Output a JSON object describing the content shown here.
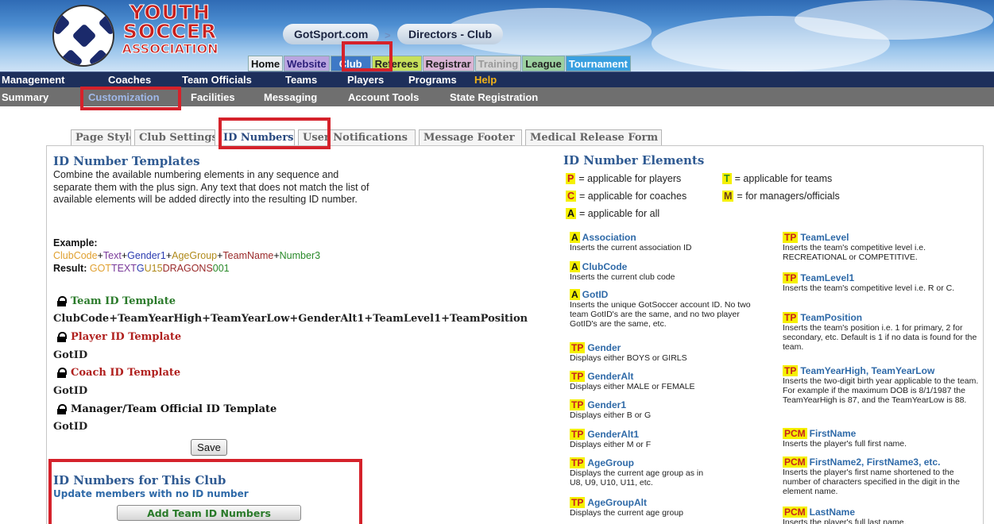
{
  "header": {
    "logo": {
      "line1": "YOUTH",
      "line2": "SOCCER",
      "line3": "ASSOCIATION"
    },
    "breadcrumb": {
      "site": "GotSport.com",
      "separator": ">",
      "section": "Directors - Club"
    },
    "top_nav": [
      "Home",
      "Website",
      "Club",
      "Referees",
      "Registrar",
      "Training",
      "League",
      "Tournament"
    ]
  },
  "menu1": [
    "Management",
    "Coaches",
    "Team Officials",
    "Teams",
    "Players",
    "Programs",
    "Help"
  ],
  "menu2": [
    "Summary",
    "Customization",
    "Facilities",
    "Messaging",
    "Account Tools",
    "State Registration"
  ],
  "tabs": [
    "Page Style",
    "Club Settings",
    "ID Numbers",
    "User Notifications",
    "Message Footer",
    "Medical Release Form"
  ],
  "templates": {
    "title": "ID Number Templates",
    "description": "Combine the available numbering elements in any sequence and separate them with the plus sign. Any text that does not match the list of available elements will be added directly into the resulting ID number.",
    "example_label": "Example:",
    "example_parts": [
      "ClubCode",
      "+",
      "Text",
      "+",
      "Gender1",
      "+",
      "AgeGroup",
      "+",
      "TeamName",
      "+",
      "Number3"
    ],
    "result_label": "Result:",
    "result_parts": [
      "GOT",
      "TEXT",
      "G",
      "U15",
      "DRAGONS",
      "001"
    ],
    "team": {
      "label": "Team ID Template",
      "value": "ClubCode+TeamYearHigh+TeamYearLow+GenderAlt1+TeamLevel1+TeamPosition",
      "color": "#2a7a2a"
    },
    "player": {
      "label": "Player ID Template",
      "value": "GotID",
      "color": "#b0201e"
    },
    "coach": {
      "label": "Coach ID Template",
      "value": "GotID",
      "color": "#b0201e"
    },
    "manager": {
      "label": "Manager/Team Official ID Template",
      "value": "GotID",
      "color": "#111111"
    },
    "save_label": "Save"
  },
  "club_ids": {
    "title": "ID Numbers for This Club",
    "subtitle": "Update members with no ID number",
    "button": "Add Team ID Numbers"
  },
  "elements": {
    "title": "ID Number Elements",
    "legend": [
      {
        "code": "P",
        "text": "= applicable for players"
      },
      {
        "code": "T",
        "text": "= applicable for teams"
      },
      {
        "code": "C",
        "text": "= applicable for coaches"
      },
      {
        "code": "M",
        "text": "= for managers/officials"
      },
      {
        "code": "A",
        "text": "= applicable for all"
      }
    ],
    "left": [
      {
        "code": "A",
        "name": "Association",
        "desc": "Inserts the current association ID"
      },
      {
        "code": "A",
        "name": "ClubCode",
        "desc": "Inserts the current club code"
      },
      {
        "code": "A",
        "name": "GotID",
        "desc": "Inserts the unique GotSoccer account ID. No two team GotID's are the same, and no two player GotID's are the same, etc."
      },
      {
        "code": "TP",
        "name": "Gender",
        "desc": "Displays either BOYS or GIRLS"
      },
      {
        "code": "TP",
        "name": "GenderAlt",
        "desc": "Displays either MALE or FEMALE"
      },
      {
        "code": "TP",
        "name": "Gender1",
        "desc": "Displays either B or G"
      },
      {
        "code": "TP",
        "name": "GenderAlt1",
        "desc": "Displays either M or F"
      },
      {
        "code": "TP",
        "name": "AgeGroup",
        "desc": "Displays the current age group as in U8, U9, U10, U11, etc."
      },
      {
        "code": "TP",
        "name": "AgeGroupAlt",
        "desc": "Displays the current age group"
      }
    ],
    "right": [
      {
        "code": "TP",
        "name": "TeamLevel",
        "desc": "Inserts the team's competitive level i.e. RECREATIONAL or COMPETITIVE."
      },
      {
        "code": "TP",
        "name": "TeamLevel1",
        "desc": "Inserts the team's competitive level i.e. R or C."
      },
      {
        "code": "TP",
        "name": "TeamPosition",
        "desc": "Inserts the team's position i.e. 1 for primary, 2 for secondary, etc. Default is 1 if no data is found for the team."
      },
      {
        "code": "TP",
        "name": "TeamYearHigh, TeamYearLow",
        "desc": "Inserts the two-digit birth year applicable to the team. For example if the maximum DOB is 8/1/1987 the TeamYearHigh is 87, and the TeamYearLow is 88."
      },
      {
        "code": "PCM",
        "name": "FirstName",
        "desc": "Inserts the player's full first name."
      },
      {
        "code": "PCM",
        "name": "FirstName2, FirstName3, etc.",
        "desc": "Inserts the player's first name shortened to the number of characters specified in the digit in the element name."
      },
      {
        "code": "PCM",
        "name": "LastName",
        "desc": "Inserts the player's full last name."
      }
    ]
  },
  "colors": {
    "highlight_red": "#d5222b",
    "menu_dark": "#1d2f5b",
    "menu_gray": "#6f6f6f",
    "heading_blue": "#2f5a92"
  }
}
